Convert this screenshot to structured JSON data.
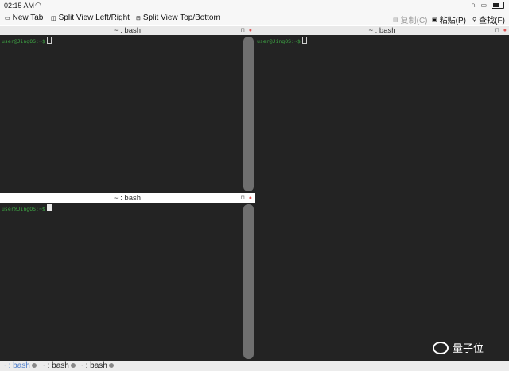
{
  "status_bar": {
    "time": "02:15 AM",
    "wifi_icon": "wifi-icon",
    "headphones_icon": "headphones-icon",
    "battery_icon": "battery-icon"
  },
  "toolbar": {
    "new_tab": "New Tab",
    "split_left_right": "Split View Left/Right",
    "split_top_bottom": "Split View Top/Bottom",
    "copy": "复制(C)",
    "paste": "粘贴(P)",
    "find": "查找(F)"
  },
  "panes": {
    "top_left": {
      "title": "~ : bash",
      "prompt": "user@JingOS:~$"
    },
    "bottom_left": {
      "title": "~ : bash",
      "prompt": "user@JingOS:~$"
    },
    "right": {
      "title": "~ : bash",
      "prompt": "user@JingOS:~$"
    }
  },
  "tabs": [
    {
      "label": "~ : bash"
    },
    {
      "label": "~ : bash"
    },
    {
      "label": "~ : bash"
    }
  ],
  "watermark": "量子位",
  "colors": {
    "terminal_bg": "#232323",
    "prompt_green": "#3ea644",
    "active_tab": "#4a7bc9"
  }
}
